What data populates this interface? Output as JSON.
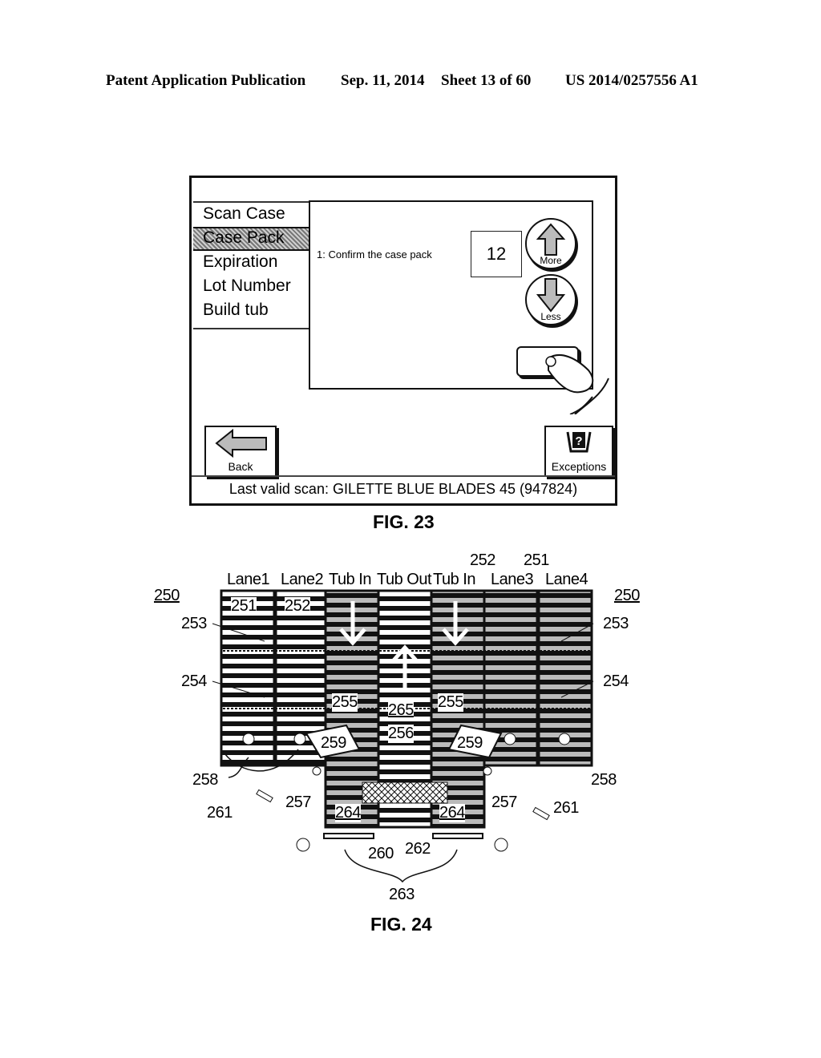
{
  "header": {
    "publication": "Patent Application Publication",
    "date": "Sep. 11, 2014",
    "sheet": "Sheet 13 of 60",
    "number": "US 2014/0257556 A1"
  },
  "fig23": {
    "caption": "FIG. 23",
    "menu": [
      {
        "label": "Scan Case",
        "selected": false
      },
      {
        "label": "Case Pack",
        "selected": true
      },
      {
        "label": "Expiration",
        "selected": false
      },
      {
        "label": "Lot Number",
        "selected": false
      },
      {
        "label": "Build tub",
        "selected": false
      }
    ],
    "instruction": "1: Confirm the case pack",
    "quantity": "12",
    "more_label": "More",
    "less_label": "Less",
    "back_label": "Back",
    "exceptions_label": "Exceptions",
    "status": "Last valid scan: GILETTE BLUE BLADES 45 (947824)"
  },
  "fig24": {
    "caption": "FIG. 24",
    "lane_headers": [
      "Lane1",
      "Lane2",
      "Tub In",
      "Tub Out",
      "Tub In",
      "Lane3",
      "Lane4"
    ],
    "refs": {
      "r250": "250",
      "r251": "251",
      "r252": "252",
      "r253": "253",
      "r254": "254",
      "r255": "255",
      "r256": "256",
      "r257": "257",
      "r258": "258",
      "r259": "259",
      "r260": "260",
      "r261": "261",
      "r262": "262",
      "r263": "263",
      "r264": "264",
      "r265": "265"
    }
  }
}
